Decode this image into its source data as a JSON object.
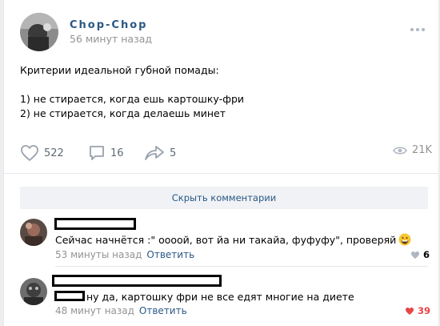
{
  "post": {
    "author": "Chop-Chop",
    "time": "56 минут назад",
    "text": {
      "line1": "Критерии идеальной губной помады:",
      "line2": "1) не стирается, когда ешь картошку-фри",
      "line3": "2) не стирается, когда делаешь минет"
    },
    "stats": {
      "likes": "522",
      "comments": "16",
      "shares": "5",
      "views": "21K"
    }
  },
  "comments_toggle": {
    "label": "Скрыть комментарии"
  },
  "comments": [
    {
      "text": "Сейчас начнётся :\" оооой, вот йа ни такайа, фуфуфу\", проверяй",
      "time": "53 минуты назад",
      "reply": "Ответить",
      "likes": "6"
    },
    {
      "text": "ну да, картошку фри не все едят многие на диете",
      "time": "48 минут назад",
      "reply": "Ответить",
      "likes": "39"
    }
  ],
  "colors": {
    "link": "#2a5885",
    "muted": "#939393",
    "liked": "#e64646",
    "icon": "#99a2ad"
  },
  "icons": {
    "more": "more-horizontal-icon",
    "like": "heart-outline-icon",
    "comment": "comment-icon",
    "share": "share-arrow-icon",
    "views": "eye-icon",
    "liked": "heart-filled-icon",
    "emoji": "grinning-face-emoji"
  }
}
